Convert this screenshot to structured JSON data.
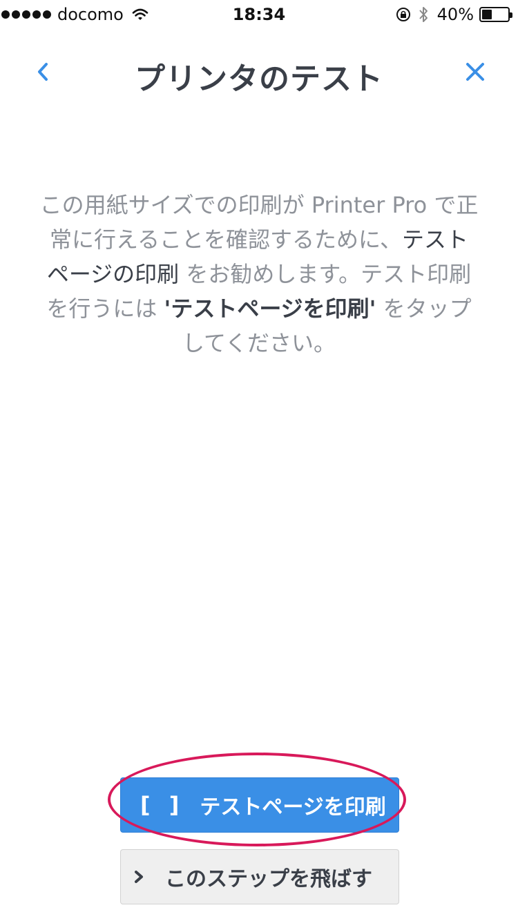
{
  "status_bar": {
    "carrier": "docomo",
    "time": "18:34",
    "battery_percent": "40%",
    "battery_level": 0.4
  },
  "nav": {
    "title": "プリンタのテスト",
    "back_icon": "chevron-left-icon",
    "close_icon": "close-icon"
  },
  "body": {
    "line1": "この用紙サイズでの印刷が Printer Pro で正",
    "line2a": "常に行えることを確認するために、",
    "line2b": "テスト",
    "line3a": "ページの印刷",
    "line3b": " をお勧めします。テスト印刷",
    "line4a": "を行うには ",
    "line4b": "'テストページを印刷'",
    "line4c": " をタップ",
    "line5": "してください。"
  },
  "buttons": {
    "print_brackets": "[ ]",
    "print_label": "テストページを印刷",
    "skip_label": "このステップを飛ばす"
  },
  "colors": {
    "accent": "#3a8fe6",
    "highlight": "#d8195a"
  }
}
